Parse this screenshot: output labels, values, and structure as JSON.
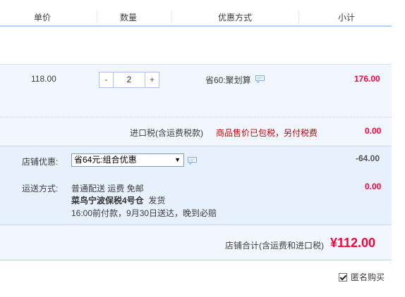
{
  "header": {
    "unit_price": "单价",
    "quantity": "数量",
    "promotion": "优惠方式",
    "subtotal": "小计"
  },
  "item": {
    "unit_price": "118.00",
    "quantity": "2",
    "minus": "-",
    "plus": "+",
    "promotion": "省60:聚划算",
    "subtotal": "176.00"
  },
  "tax": {
    "label": "进口税(含运费税款)",
    "note": "商品售价已包税，另付税费",
    "value": "0.00"
  },
  "shop_discount": {
    "label": "店铺优惠:",
    "selected": "省64元:组合优惠",
    "value": "-64.00"
  },
  "shipping": {
    "label": "运送方式:",
    "line1": "普通配送 运费 免邮",
    "warehouse": "菜鸟宁波保税4号仓",
    "dispatch": "发货",
    "line3": "16:00前付款，9月30日送达，晚到必赔",
    "value": "0.00"
  },
  "total": {
    "label": "店铺合计(含运费和进口税)",
    "value": "¥112.00"
  },
  "anonymous": {
    "label": "匿名购买",
    "checked": true
  },
  "colors": {
    "price_red": "#ff0036",
    "accent_blue": "#b2d1ff",
    "row_bg": "#f2f7ff"
  }
}
